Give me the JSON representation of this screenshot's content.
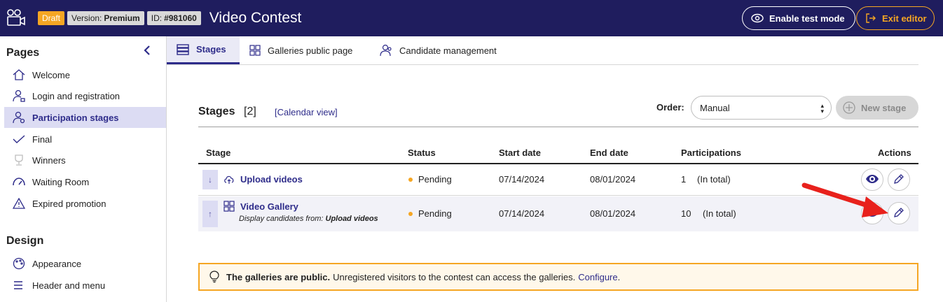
{
  "header": {
    "badge_draft": "Draft",
    "version_label": "Version:",
    "version_value": "Premium",
    "id_label": "ID:",
    "id_value": "#981060",
    "title": "Video Contest",
    "test_mode_label": "Enable test mode",
    "exit_label": "Exit editor"
  },
  "sidebar": {
    "pages_heading": "Pages",
    "items": [
      {
        "label": "Welcome",
        "icon": "home-icon"
      },
      {
        "label": "Login and registration",
        "icon": "user-lock-icon"
      },
      {
        "label": "Participation stages",
        "icon": "user-gear-icon"
      },
      {
        "label": "Final",
        "icon": "check-icon"
      },
      {
        "label": "Winners",
        "icon": "trophy-icon"
      },
      {
        "label": "Waiting Room",
        "icon": "gauge-icon"
      },
      {
        "label": "Expired promotion",
        "icon": "warning-icon"
      }
    ],
    "design_heading": "Design",
    "design_items": [
      {
        "label": "Appearance",
        "icon": "palette-icon"
      },
      {
        "label": "Header and menu",
        "icon": "menu-icon"
      }
    ]
  },
  "tabs": [
    {
      "label": "Stages",
      "icon": "list-icon",
      "active": true
    },
    {
      "label": "Galleries public page",
      "icon": "grid-icon",
      "active": false
    },
    {
      "label": "Candidate management",
      "icon": "users-icon",
      "active": false
    }
  ],
  "stages": {
    "title": "Stages",
    "count": "[2]",
    "calendar_link": "[Calendar view]",
    "order_label": "Order:",
    "order_value": "Manual",
    "new_stage_label": "New stage",
    "columns": [
      "Stage",
      "Status",
      "Start date",
      "End date",
      "Participations",
      "Actions"
    ],
    "rows": [
      {
        "move": "↓",
        "icon": "cloud-upload-icon",
        "name": "Upload videos",
        "subtitle_prefix": "",
        "subtitle_value": "",
        "status": "Pending",
        "start": "07/14/2024",
        "end": "08/01/2024",
        "participations": "1",
        "participations_note": "(In total)"
      },
      {
        "move": "↑",
        "icon": "gallery-grid-icon",
        "name": "Video Gallery",
        "subtitle_prefix": "Display candidates from: ",
        "subtitle_value": "Upload videos",
        "status": "Pending",
        "start": "07/14/2024",
        "end": "08/01/2024",
        "participations": "10",
        "participations_note": "(In total)"
      }
    ]
  },
  "notice": {
    "bold": "The galleries are public.",
    "text": "Unregistered visitors to the contest can access the galleries.",
    "link": "Configure",
    "suffix": "."
  },
  "colors": {
    "navbar": "#1f1d5e",
    "accent": "#2e2c8a",
    "draft": "#f5a623",
    "arrow": "#e8211c"
  }
}
